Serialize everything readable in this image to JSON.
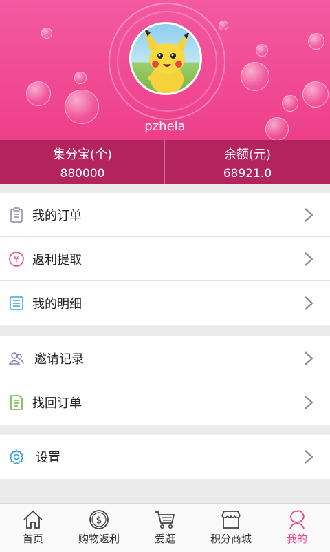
{
  "profile": {
    "username": "pzhela",
    "avatar": "pikachu-avatar"
  },
  "stats": [
    {
      "label": "集分宝(个)",
      "value": "880000"
    },
    {
      "label": "余额(元)",
      "value": "68921.0"
    }
  ],
  "menu_groups": [
    [
      {
        "label": "我的订单",
        "icon": "clipboard-icon"
      },
      {
        "label": "返利提取",
        "icon": "yen-icon"
      },
      {
        "label": "我的明细",
        "icon": "list-icon"
      }
    ],
    [
      {
        "label": "邀请记录",
        "icon": "users-icon"
      },
      {
        "label": "找回订单",
        "icon": "document-icon"
      }
    ],
    [
      {
        "label": "设置",
        "icon": "gear-icon"
      }
    ]
  ],
  "nav": [
    {
      "label": "首页",
      "icon": "home-icon"
    },
    {
      "label": "购物返利",
      "icon": "dollar-coin-icon"
    },
    {
      "label": "爱逛",
      "icon": "cart-icon"
    },
    {
      "label": "积分商城",
      "icon": "store-icon"
    },
    {
      "label": "我的",
      "icon": "profile-icon",
      "active": true
    }
  ],
  "colors": {
    "header": "#f04b92",
    "stats_bar": "#b3245f",
    "active_nav": "#e8458f"
  }
}
